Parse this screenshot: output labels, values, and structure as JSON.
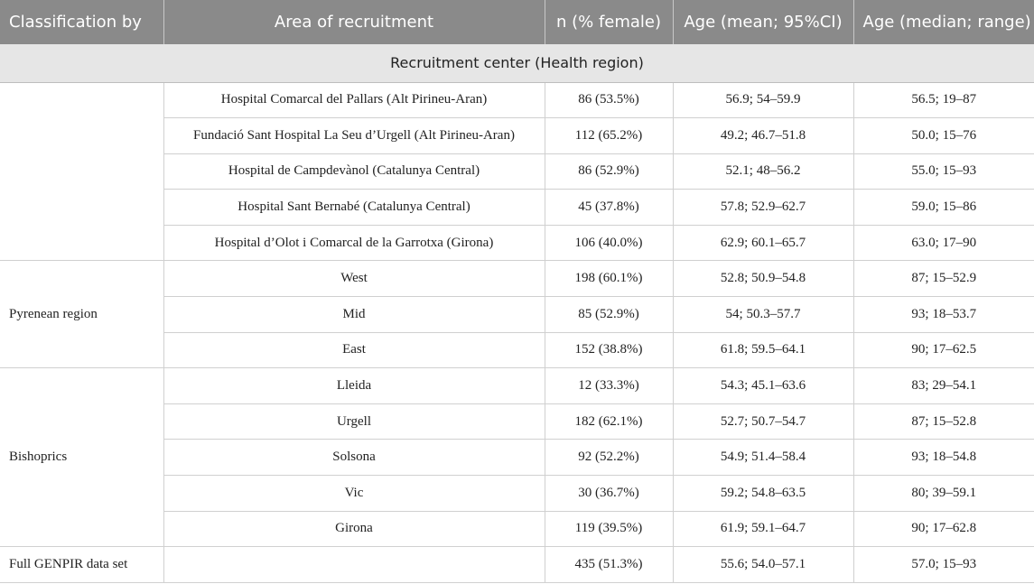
{
  "table": {
    "headers": [
      "Classification by",
      "Area of recruitment",
      "n (% female)",
      "Age (mean; 95%CI)",
      "Age (median; range)"
    ],
    "section_label": "Recruitment center (Health region)",
    "groups": [
      {
        "label": "",
        "rows": [
          [
            "Hospital Comarcal del Pallars (Alt Pirineu-Aran)",
            "86 (53.5%)",
            "56.9; 54–59.9",
            "56.5; 19–87"
          ],
          [
            "Fundació Sant Hospital La Seu d’Urgell (Alt Pirineu-Aran)",
            "112 (65.2%)",
            "49.2; 46.7–51.8",
            "50.0; 15–76"
          ],
          [
            "Hospital de Campdevànol (Catalunya Central)",
            "86 (52.9%)",
            "52.1; 48–56.2",
            "55.0; 15–93"
          ],
          [
            "Hospital Sant Bernabé (Catalunya Central)",
            "45 (37.8%)",
            "57.8; 52.9–62.7",
            "59.0; 15–86"
          ],
          [
            "Hospital d’Olot i Comarcal de la Garrotxa (Girona)",
            "106 (40.0%)",
            "62.9; 60.1–65.7",
            "63.0; 17–90"
          ]
        ]
      },
      {
        "label": "Pyrenean region",
        "rows": [
          [
            "West",
            "198 (60.1%)",
            "52.8; 50.9–54.8",
            "87; 15–52.9"
          ],
          [
            "Mid",
            "85 (52.9%)",
            "54; 50.3–57.7",
            "93; 18–53.7"
          ],
          [
            "East",
            "152 (38.8%)",
            "61.8; 59.5–64.1",
            "90; 17–62.5"
          ]
        ]
      },
      {
        "label": "Bishoprics",
        "rows": [
          [
            "Lleida",
            "12 (33.3%)",
            "54.3; 45.1–63.6",
            "83; 29–54.1"
          ],
          [
            "Urgell",
            "182 (62.1%)",
            "52.7; 50.7–54.7",
            "87; 15–52.8"
          ],
          [
            "Solsona",
            "92 (52.2%)",
            "54.9; 51.4–58.4",
            "93; 18–54.8"
          ],
          [
            "Vic",
            "30 (36.7%)",
            "59.2; 54.8–63.5",
            "80; 39–59.1"
          ],
          [
            "Girona",
            "119 (39.5%)",
            "61.9; 59.1–64.7",
            "90; 17–62.8"
          ]
        ]
      },
      {
        "label": "Full GENPIR data set",
        "rows": [
          [
            "",
            "435 (51.3%)",
            "55.6; 54.0–57.1",
            "57.0; 15–93"
          ]
        ]
      }
    ]
  }
}
